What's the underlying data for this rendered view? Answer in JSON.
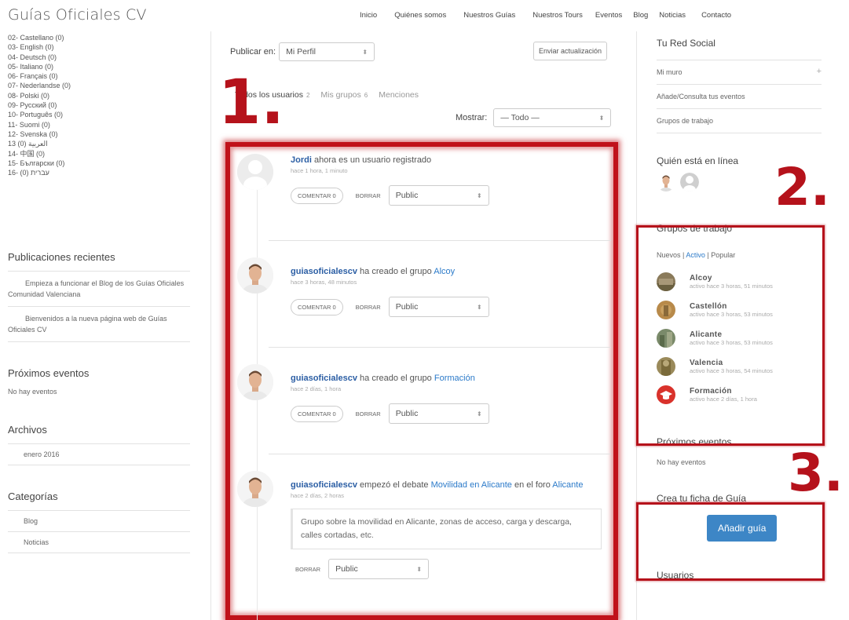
{
  "site": {
    "title": "Guías Oficiales CV"
  },
  "nav": [
    "Inicio",
    "Quiénes somos",
    "Nuestros Guías",
    "Nuestros Tours",
    "Eventos",
    "Blog",
    "Noticias",
    "Contacto"
  ],
  "languages": [
    "02- Castellano (0)",
    "03- English (0)",
    "04- Deutsch (0)",
    "05- Italiano (0)",
    "06- Français (0)",
    "07- Nederlandse (0)",
    "08- Polski (0)",
    "09- Русский (0)",
    "10- Português (0)",
    "11- Suomi (0)",
    "12- Svenska (0)",
    "13 (0) العربية",
    "14- 中国 (0)",
    "15- Български (0)",
    "16- (0) עברית"
  ],
  "recent_posts": {
    "title": "Publicaciones recientes",
    "items": [
      "Empieza a funcionar el Blog de los Guías Oficiales Comunidad Valenciana",
      "Bienvenidos a la nueva página web de Guías Oficiales CV"
    ]
  },
  "upcoming_left": {
    "title": "Próximos eventos",
    "empty": "No hay eventos"
  },
  "archives": {
    "title": "Archivos",
    "items": [
      "enero 2016"
    ]
  },
  "categories": {
    "title": "Categorías",
    "items": [
      "Blog",
      "Noticias"
    ]
  },
  "publish": {
    "label": "Publicar en:",
    "value": "Mi Perfil",
    "send": "Enviar actualización"
  },
  "tabs": [
    {
      "label": "Todos los usuarios",
      "count": "2"
    },
    {
      "label": "Mis grupos",
      "count": "6"
    },
    {
      "label": "Menciones",
      "count": ""
    }
  ],
  "show": {
    "label": "Mostrar:",
    "value": "— Todo —"
  },
  "annotations": [
    "1.",
    "2.",
    "3."
  ],
  "activities": [
    {
      "user": "Jordi",
      "text": " ahora es un usuario registrado",
      "link": "",
      "text2": "",
      "link2": "",
      "time": "hace 1 hora, 1 minuto",
      "comment": "COMENTAR 0",
      "delete": "BORRAR",
      "privacy": "Public",
      "quote": ""
    },
    {
      "user": "guiasoficialescv",
      "text": " ha creado el grupo ",
      "link": "Alcoy",
      "text2": "",
      "link2": "",
      "time": "hace 3 horas, 48 minutos",
      "comment": "COMENTAR 0",
      "delete": "BORRAR",
      "privacy": "Public",
      "quote": ""
    },
    {
      "user": "guiasoficialescv",
      "text": " ha creado el grupo ",
      "link": "Formación",
      "text2": "",
      "link2": "",
      "time": "hace 2 días, 1 hora",
      "comment": "COMENTAR 0",
      "delete": "BORRAR",
      "privacy": "Public",
      "quote": ""
    },
    {
      "user": "guiasoficialescv",
      "text": " empezó el debate ",
      "link": "Movilidad en Alicante",
      "text2": " en el foro ",
      "link2": "Alicante",
      "time": "hace 2 días, 2 horas",
      "comment": "",
      "delete": "BORRAR",
      "privacy": "Public",
      "quote": "Grupo sobre la movilidad en Alicante, zonas de acceso, carga y descarga, calles cortadas, etc."
    }
  ],
  "social": {
    "title": "Tu Red Social",
    "items": [
      "Mi muro",
      "Añade/Consulta tus eventos",
      "Grupos de trabajo"
    ],
    "plus": "+"
  },
  "online": {
    "title": "Quién está en línea"
  },
  "groups": {
    "title": "Grupos de trabajo",
    "filters": [
      "Nuevos",
      "Activo",
      "Popular"
    ],
    "separator": "|",
    "items": [
      {
        "name": "Alcoy",
        "time": "activo hace 3 horas, 51 minutos",
        "color": "#8a7a5a"
      },
      {
        "name": "Castellón",
        "time": "activo hace 3 horas, 53 minutos",
        "color": "#b88a4a"
      },
      {
        "name": "Alicante",
        "time": "activo hace 3 horas, 53 minutos",
        "color": "#7a8a6a"
      },
      {
        "name": "Valencia",
        "time": "activo hace 3 horas, 54 minutos",
        "color": "#9a8a5a"
      },
      {
        "name": "Formación",
        "time": "activo hace 2 días, 1 hora",
        "color": "#d9322b"
      }
    ]
  },
  "upcoming_right": {
    "title": "Próximos eventos",
    "empty": "No hay eventos"
  },
  "guide": {
    "title": "Crea tu ficha de Guía",
    "button": "Añadir guía"
  },
  "users": {
    "title": "Usuarios"
  },
  "colors": {
    "annotation_red": "#b5121b",
    "link_blue": "#2b7ac9",
    "button_blue": "#3d86c6"
  }
}
